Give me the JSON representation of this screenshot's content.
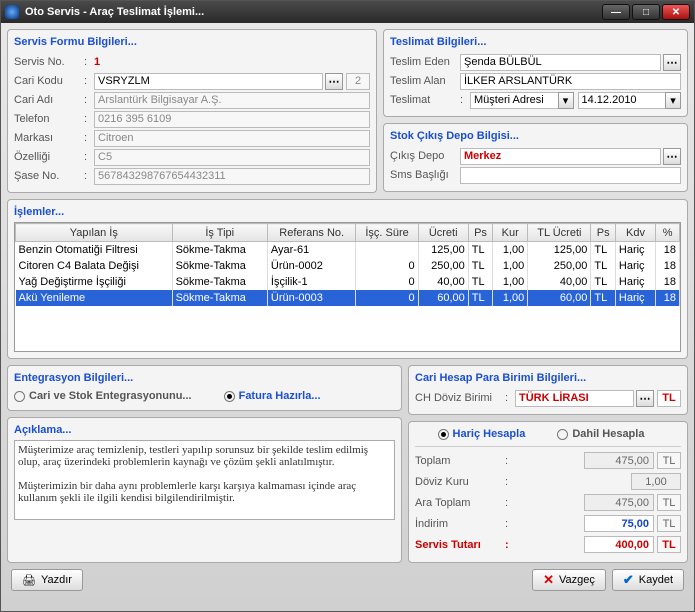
{
  "window": {
    "title": "Oto Servis - Araç Teslimat İşlemi..."
  },
  "sections": {
    "serviceForm": "Servis Formu Bilgileri...",
    "delivery": "Teslimat Bilgileri...",
    "depot": "Stok Çıkış Depo Bilgisi...",
    "ops": "İşlemler...",
    "integ": "Entegrasyon Bilgileri...",
    "desc": "Açıklama...",
    "currency": "Cari Hesap Para Birimi Bilgileri..."
  },
  "form": {
    "servisNoLabel": "Servis No.",
    "servisNo": "1",
    "cariKoduLabel": "Cari Kodu",
    "cariKodu": "VSRYZLM",
    "cariKoduExtra": "2",
    "cariAdiLabel": "Cari Adı",
    "cariAdi": "Arslantürk Bilgisayar A.Ş.",
    "telefonLabel": "Telefon",
    "telefon": "0216 395 6109",
    "markaLabel": "Markası",
    "marka": "Citroen",
    "ozellikLabel": "Özelliği",
    "ozellik": "C5",
    "saseLabel": "Şase No.",
    "sase": "567843298767654432311"
  },
  "delivery": {
    "teslimEdenLabel": "Teslim Eden",
    "teslimEden": "Şenda BÜLBÜL",
    "teslimAlanLabel": "Teslim Alan",
    "teslimAlan": "İLKER ARSLANTÜRK",
    "teslimatLabel": "Teslimat",
    "teslimat": "Müşteri Adresi",
    "date": "14.12.2010"
  },
  "depot": {
    "cikisDepoLabel": "Çıkış Depo",
    "cikisDepo": "Merkez",
    "smsLabel": "Sms Başlığı",
    "sms": ""
  },
  "grid": {
    "cols": [
      "Yapılan İş",
      "İş Tipi",
      "Referans No.",
      "İşç. Süre",
      "Ücreti",
      "Ps",
      "Kur",
      "TL Ücreti",
      "Ps",
      "Kdv",
      "%"
    ],
    "rows": [
      {
        "is": "Benzin Otomatiği Filtresi",
        "tip": "Sökme-Takma",
        "ref": "Ayar-61",
        "sure": "",
        "ucret": "125,00",
        "ps1": "TL",
        "kur": "1,00",
        "tlucret": "125,00",
        "ps2": "TL",
        "kdv": "Hariç",
        "pct": "18"
      },
      {
        "is": "Citoren C4 Balata Değişi",
        "tip": "Sökme-Takma",
        "ref": "Ürün-0002",
        "sure": "0",
        "ucret": "250,00",
        "ps1": "TL",
        "kur": "1,00",
        "tlucret": "250,00",
        "ps2": "TL",
        "kdv": "Hariç",
        "pct": "18"
      },
      {
        "is": "Yağ Değiştirme İşçiliği",
        "tip": "Sökme-Takma",
        "ref": "İşçilik-1",
        "sure": "0",
        "ucret": "40,00",
        "ps1": "TL",
        "kur": "1,00",
        "tlucret": "40,00",
        "ps2": "TL",
        "kdv": "Hariç",
        "pct": "18"
      },
      {
        "is": "Akü Yenileme",
        "tip": "Sökme-Takma",
        "ref": "Ürün-0003",
        "sure": "0",
        "ucret": "60,00",
        "ps1": "TL",
        "kur": "1,00",
        "tlucret": "60,00",
        "ps2": "TL",
        "kdv": "Hariç",
        "pct": "18",
        "sel": true
      }
    ]
  },
  "integ": {
    "opt1": "Cari ve Stok Entegrasyonunu...",
    "opt2": "Fatura Hazırla..."
  },
  "desc": {
    "text": "Müşterimize araç temizlenip, testleri yapılıp sorunsuz bir şekilde teslim edilmiş olup, araç üzerindeki problemlerin kaynağı ve çözüm şekli anlatılmıştır.\n\nMüşterimizin bir daha aynı problemlerle karşı karşıya kalmaması içinde araç kullanım şekli ile ilgili kendisi bilgilendirilmiştir."
  },
  "currency": {
    "chLabel": "CH Döviz Birimi",
    "ch": "TÜRK LİRASI",
    "chCode": "TL",
    "haric": "Hariç Hesapla",
    "dahil": "Dahil Hesapla"
  },
  "totals": {
    "toplamLabel": "Toplam",
    "toplam": "475,00",
    "kurLabel": "Döviz Kuru",
    "kur": "1,00",
    "araLabel": "Ara Toplam",
    "ara": "475,00",
    "indLabel": "İndirim",
    "ind": "75,00",
    "servisLabel": "Servis Tutarı",
    "servis": "400,00",
    "tl": "TL"
  },
  "footer": {
    "print": "Yazdır",
    "cancel": "Vazgeç",
    "save": "Kaydet"
  }
}
